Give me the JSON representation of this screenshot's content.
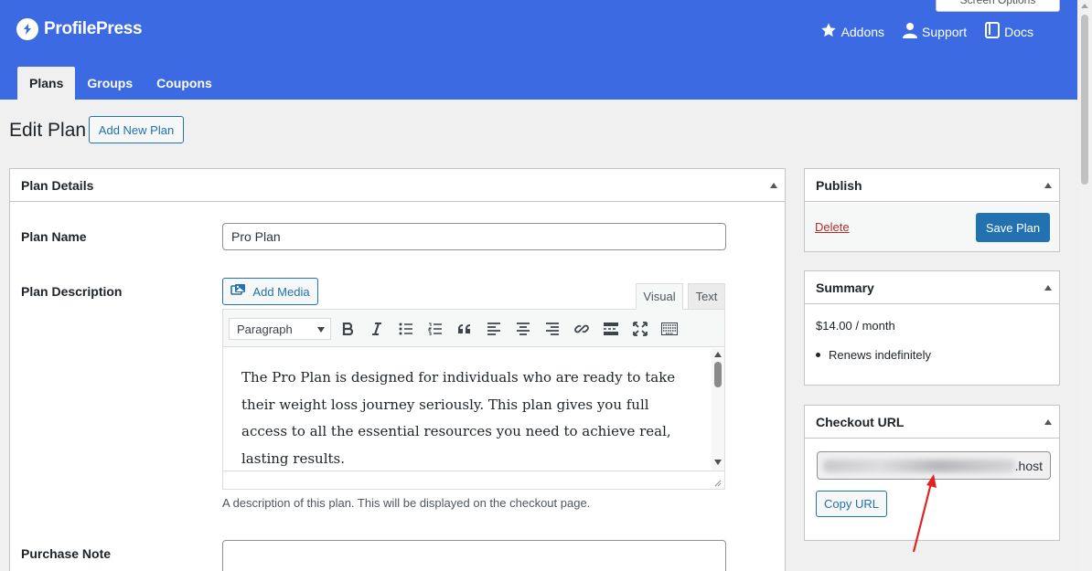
{
  "brand": {
    "name": "ProfilePress",
    "icon": "profilepress-logo-icon"
  },
  "header": {
    "screen_options": "Screen Options",
    "links": [
      {
        "label": "Addons",
        "icon": "star-icon"
      },
      {
        "label": "Support",
        "icon": "user-icon"
      },
      {
        "label": "Docs",
        "icon": "book-icon"
      }
    ]
  },
  "tabs": [
    {
      "label": "Plans",
      "active": true
    },
    {
      "label": "Groups",
      "active": false
    },
    {
      "label": "Coupons",
      "active": false
    }
  ],
  "page": {
    "title": "Edit Plan",
    "add_new_label": "Add New Plan"
  },
  "plan_details": {
    "title": "Plan Details",
    "plan_name_label": "Plan Name",
    "plan_name_value": "Pro Plan",
    "description_label": "Plan Description",
    "add_media_label": "Add Media",
    "visual_tab": "Visual",
    "text_tab": "Text",
    "format_value": "Paragraph",
    "description_text": "The Pro Plan is designed for individuals who are ready to take their weight loss journey seriously. This plan gives you full access to all the essential resources you need to achieve real, lasting results.",
    "description_help": "A description of this plan. This will be displayed on the checkout page.",
    "purchase_note_label": "Purchase Note"
  },
  "publish": {
    "title": "Publish",
    "delete_label": "Delete",
    "save_label": "Save Plan"
  },
  "summary": {
    "title": "Summary",
    "price": "$14.00 / month",
    "renewal": "Renews indefinitely"
  },
  "checkout": {
    "title": "Checkout URL",
    "url_suffix": ".host",
    "copy_label": "Copy URL"
  },
  "colors": {
    "header": "#3c6ae3",
    "primary": "#2271b1",
    "delete": "#b32d2e",
    "annotation_arrow": "#e02424"
  }
}
